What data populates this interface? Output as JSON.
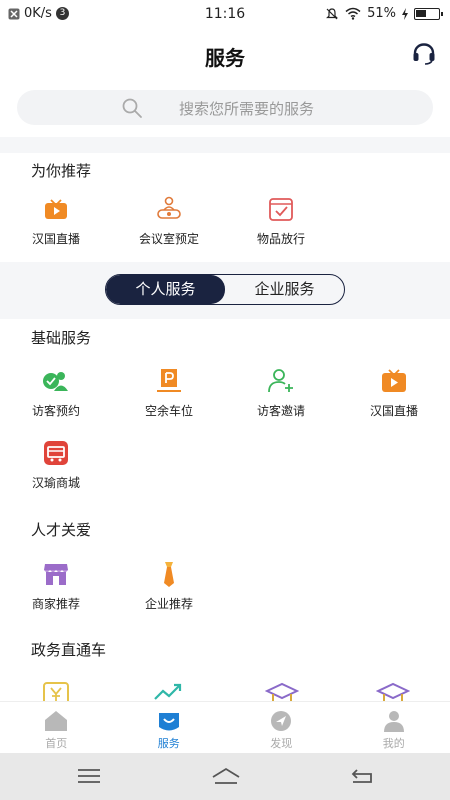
{
  "status": {
    "net_speed": "0K/s",
    "notif_count": "3",
    "time": "11:16",
    "battery_pct": "51%",
    "battery_level": 0.51
  },
  "header": {
    "title": "服务"
  },
  "search": {
    "placeholder": "搜索您所需要的服务"
  },
  "recommend": {
    "title": "为你推荐",
    "items": [
      {
        "label": "汉国直播",
        "icon": "live-tv-icon"
      },
      {
        "label": "会议室预定",
        "icon": "meeting-room-icon"
      },
      {
        "label": "物品放行",
        "icon": "goods-release-icon"
      }
    ]
  },
  "segment": {
    "personal": "个人服务",
    "enterprise": "企业服务"
  },
  "basic": {
    "title": "基础服务",
    "items": [
      {
        "label": "访客预约",
        "icon": "visitor-booking-icon"
      },
      {
        "label": "空余车位",
        "icon": "parking-icon"
      },
      {
        "label": "访客邀请",
        "icon": "visitor-invite-icon"
      },
      {
        "label": "汉国直播",
        "icon": "live-tv-icon"
      },
      {
        "label": "汉瑜商城",
        "icon": "mall-icon"
      }
    ]
  },
  "talent": {
    "title": "人才关爱",
    "items": [
      {
        "label": "商家推荐",
        "icon": "shop-icon"
      },
      {
        "label": "企业推荐",
        "icon": "enterprise-icon"
      }
    ]
  },
  "gov": {
    "title": "政务直通车"
  },
  "tabs": [
    {
      "label": "首页"
    },
    {
      "label": "服务"
    },
    {
      "label": "发现"
    },
    {
      "label": "我的"
    }
  ],
  "colors": {
    "accent": "#1e7fd4",
    "orange": "#f08a24",
    "green": "#3bb55a",
    "navy": "#1a2340"
  }
}
